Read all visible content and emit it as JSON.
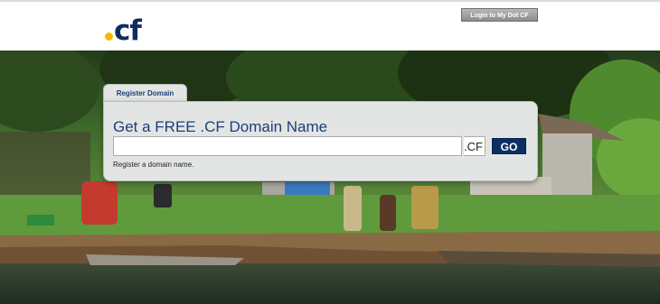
{
  "header": {
    "logo_text": "cf",
    "login_label": "Login to My Dot CF"
  },
  "register": {
    "tab_label": "Register Domain",
    "title": "Get a FREE .CF Domain Name",
    "input_value": "",
    "suffix": ".CF",
    "go_label": "GO",
    "helper": "Register a domain name."
  },
  "colors": {
    "brand_navy": "#0f2c5c",
    "brand_yellow": "#f5b800",
    "card_bg": "#e3e5e5",
    "go_button": "#0d2f63"
  },
  "icons": [
    "logo-dot-icon"
  ]
}
